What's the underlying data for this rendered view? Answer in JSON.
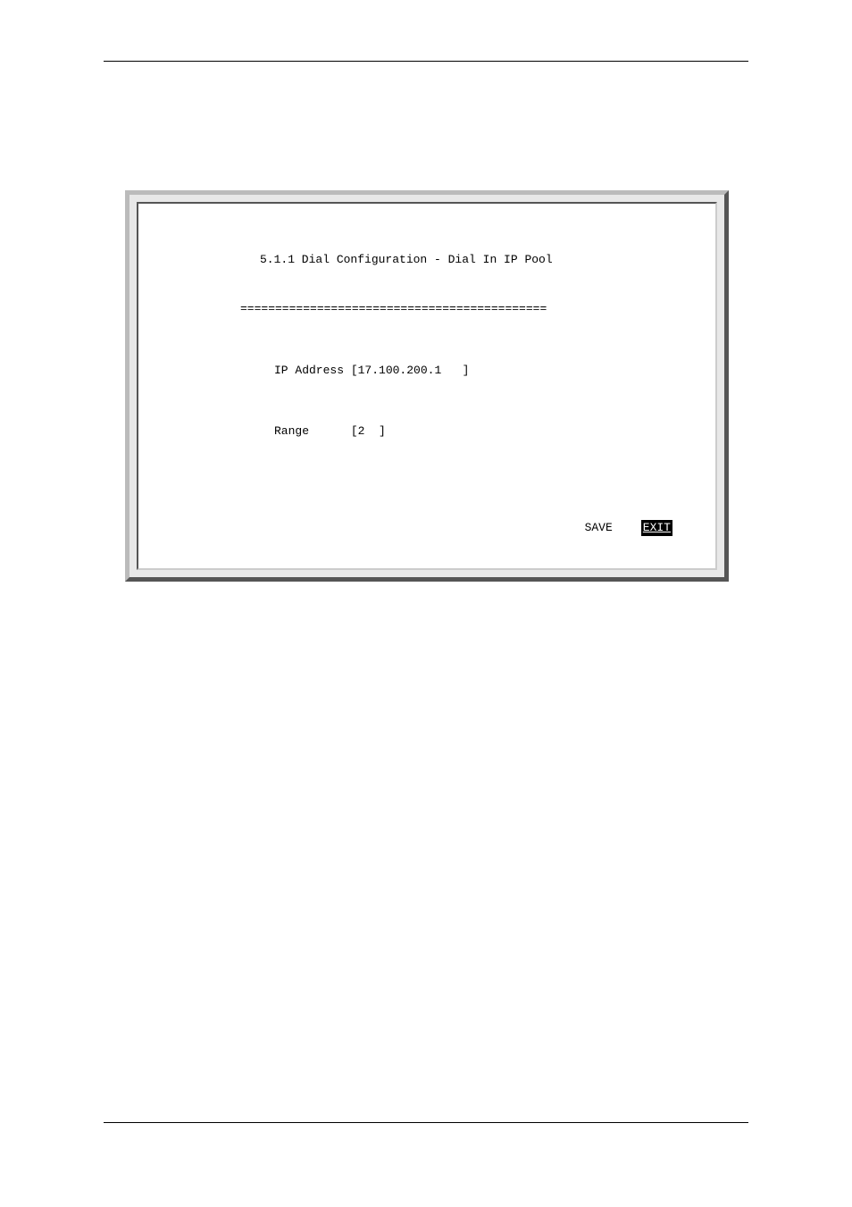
{
  "terminal": {
    "title": "5.1.1 Dial Configuration - Dial In IP Pool",
    "divider": "============================================",
    "ip_label": "IP Address",
    "ip_value": "17.100.200.1",
    "range_label": "Range",
    "range_value": "2",
    "save_label": "SAVE",
    "exit_label": "EXIT"
  }
}
